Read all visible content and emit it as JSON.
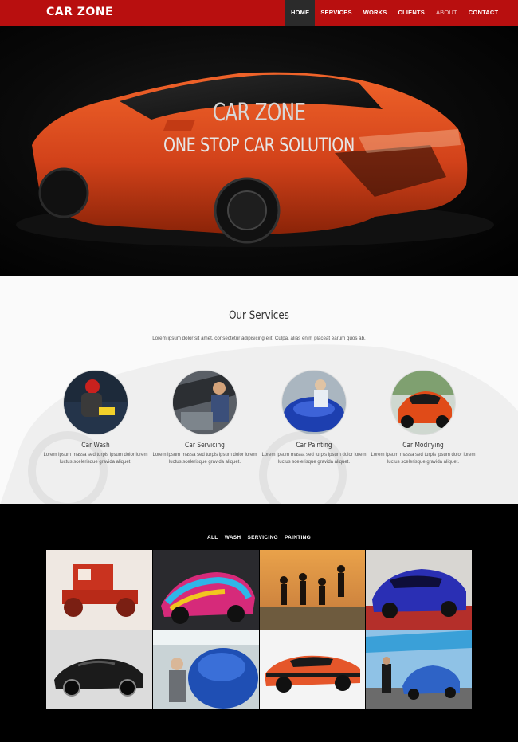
{
  "brand": "CAR ZONE",
  "nav": {
    "items": [
      "HOME",
      "SERVICES",
      "WORKS",
      "CLIENTS",
      "ABOUT",
      "CONTACT"
    ],
    "active": "HOME"
  },
  "hero": {
    "title": "CAR ZONE",
    "subtitle": "ONE STOP CAR SOLUTION"
  },
  "services": {
    "title": "Our Services",
    "intro": "Lorem ipsum dolor sit amet, consectetur adipisicing elit. Culpa, alias enim placeat earum quos ab.",
    "items": [
      {
        "title": "Car Wash",
        "text": "Lorem ipsum massa sed turpis ipsum dolor lorem luctus scelerisque gravida aliquet."
      },
      {
        "title": "Car Servicing",
        "text": "Lorem ipsum massa sed turpis ipsum dolor lorem luctus scelerisque gravida aliquet."
      },
      {
        "title": "Car Painting",
        "text": "Lorem ipsum massa sed turpis ipsum dolor lorem luctus scelerisque gravida aliquet."
      },
      {
        "title": "Car Modifying",
        "text": "Lorem ipsum massa sed turpis ipsum dolor lorem luctus scelerisque gravida aliquet."
      }
    ]
  },
  "portfolio": {
    "filters": [
      "ALL",
      "WASH",
      "SERVICING",
      "PAINTING"
    ]
  },
  "colors": {
    "nav_red": "#b80f0f",
    "accent_orange": "#e0481a"
  }
}
